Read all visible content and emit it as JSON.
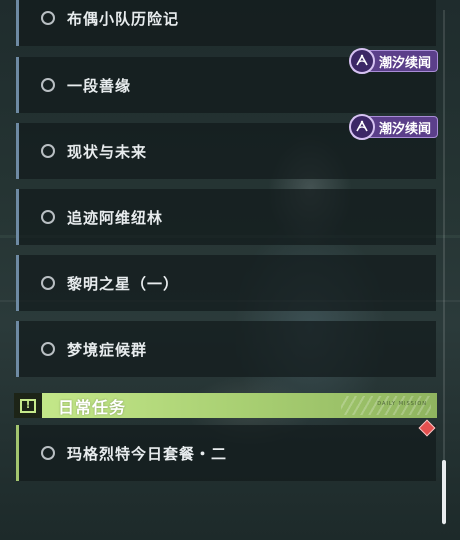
{
  "quests": [
    {
      "label": "布偶小队历险记"
    },
    {
      "label": "一段善缘"
    },
    {
      "label": "现状与未来"
    },
    {
      "label": "追迹阿维纽林"
    },
    {
      "label": "黎明之星（一）"
    },
    {
      "label": "梦境症候群"
    }
  ],
  "tide_badges": [
    {
      "label": "潮汐续闻"
    },
    {
      "label": "潮汐续闻"
    }
  ],
  "daily_section": {
    "title": "日常任务",
    "alert_icon": "exclamation-icon",
    "decor_text": "DAILY MISSION",
    "accent_color": "#c7ea8c",
    "items": [
      {
        "label": "玛格烈特今日套餐・二"
      }
    ]
  },
  "colors": {
    "badge_purple": "#5b3f8a",
    "quest_border": "#6e8aa3",
    "alert_red": "#e4504f"
  },
  "scroll": {
    "position": 0.93
  }
}
